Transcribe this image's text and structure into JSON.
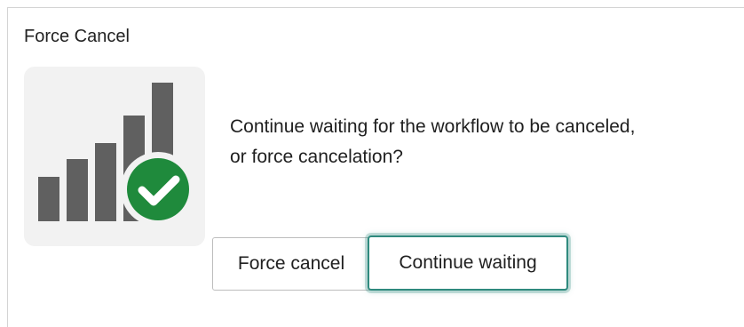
{
  "dialog": {
    "title": "Force Cancel",
    "message_line1": "Continue waiting for the workflow to be canceled,",
    "message_line2": "or force cancelation?",
    "force_cancel_label": "Force cancel",
    "continue_waiting_label": "Continue waiting"
  },
  "illustration": {
    "icon": "bar-chart-with-check-icon",
    "bar_color": "#606060",
    "check_badge_color": "#1f8a3c"
  },
  "colors": {
    "focus_ring": "#2f8a7e",
    "text": "#1f1f1f",
    "border": "#bdbdbd"
  }
}
